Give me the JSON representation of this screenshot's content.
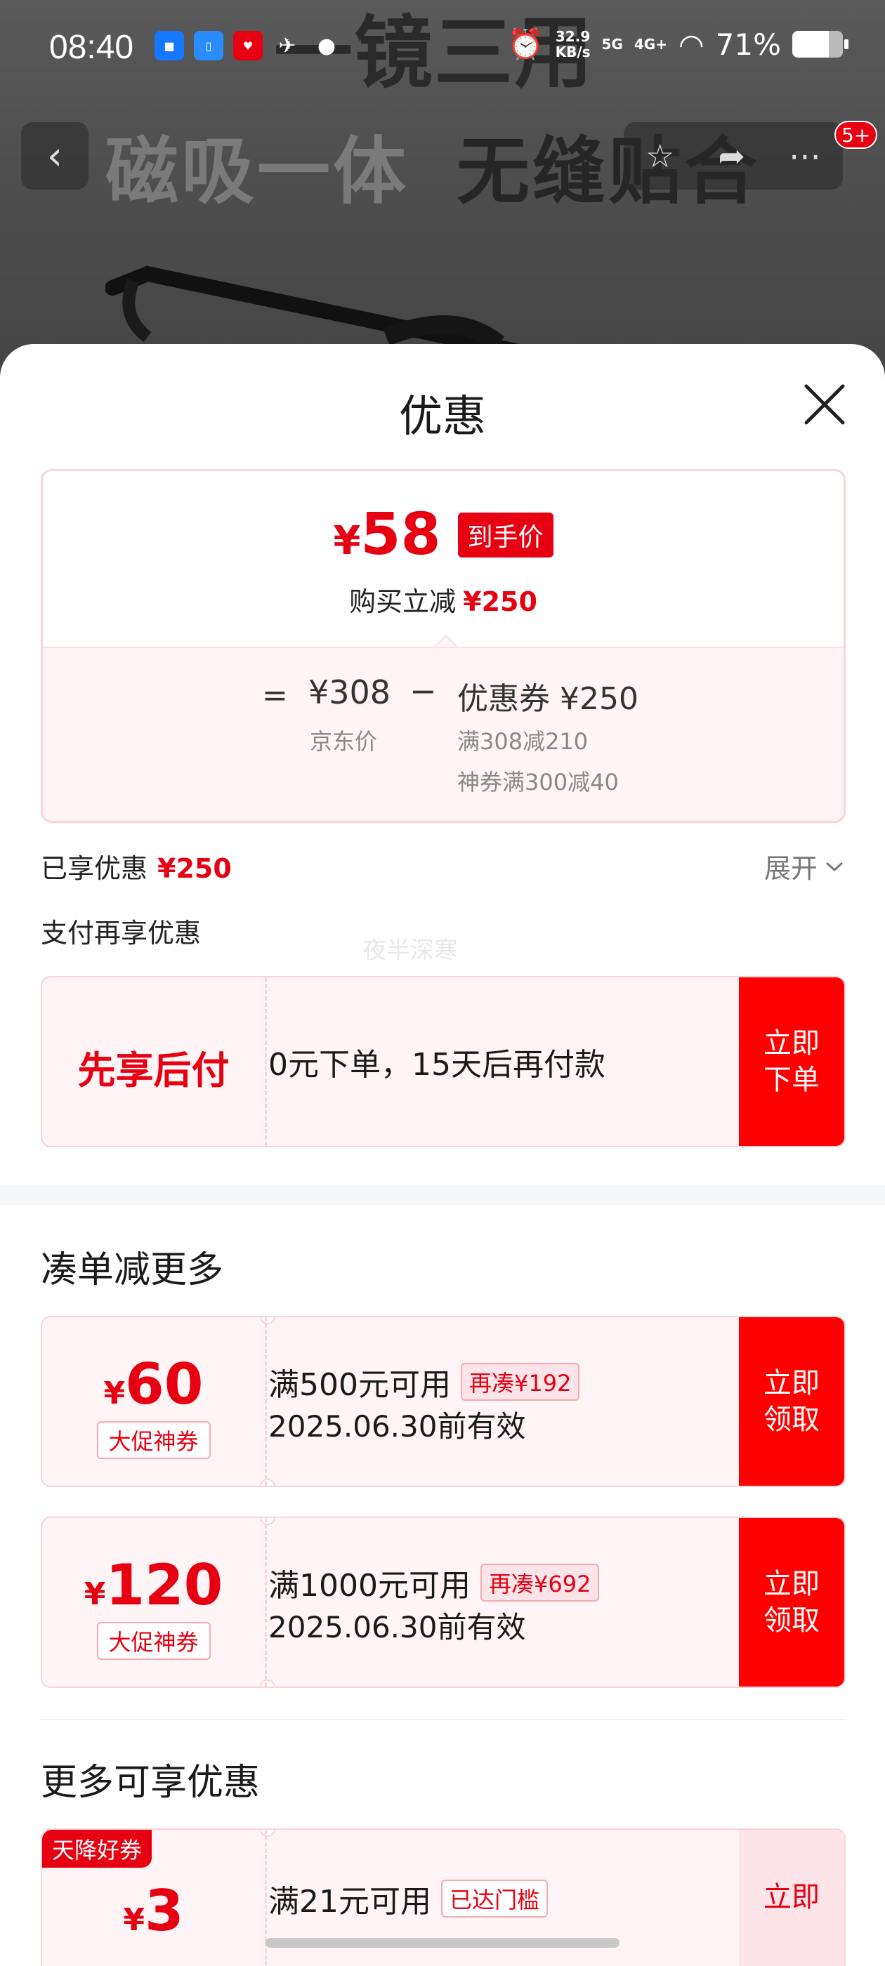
{
  "background": {
    "headline": "一镜三用",
    "sub_light": "磁吸一体",
    "sub_dark": "无缝贴合"
  },
  "status_bar": {
    "time": "08:40",
    "app_icons": [
      "pay-app-icon",
      "phone-app-icon",
      "gift-app-icon",
      "bird-app-icon",
      "wechat-icon"
    ],
    "net_speed_value": "32.9",
    "net_speed_unit": "KB/s",
    "signal_5g": "5G",
    "signal_4g": "4G+",
    "battery": "71%"
  },
  "product_nav": {
    "cart_badge": "5+"
  },
  "sheet": {
    "title": "优惠",
    "price_card": {
      "currency": "¥",
      "final_price": "58",
      "final_tag": "到手价",
      "saving_label": "购买立减",
      "saving_value": "¥250",
      "equals": "=",
      "jd_price": "¥308",
      "jd_label": "京东价",
      "minus": "−",
      "coupon_total": "优惠券 ¥250",
      "rule_1": "满308减210",
      "rule_2": "神券满300减40"
    },
    "enjoyed_label": "已享优惠",
    "enjoyed_value": "¥250",
    "expand_label": "展开",
    "pay_more_label": "支付再享优惠",
    "watermark": "夜半深寒",
    "bnpl": {
      "title": "先享后付",
      "description": "0元下单，15天后再付款",
      "cta": "立即下单"
    },
    "section_more": "凑单减更多",
    "coupons": [
      {
        "currency": "¥",
        "amount": "60",
        "type": "大促神券",
        "condition": "满500元可用",
        "tag": "再凑¥192",
        "validity": "2025.06.30前有效",
        "cta": "立即领取"
      },
      {
        "currency": "¥",
        "amount": "120",
        "type": "大促神券",
        "condition": "满1000元可用",
        "tag": "再凑¥692",
        "validity": "2025.06.30前有效",
        "cta": "立即领取"
      }
    ],
    "section_available": "更多可享优惠",
    "available_coupon": {
      "ribbon": "天降好券",
      "currency": "¥",
      "amount": "3",
      "condition": "满21元可用",
      "tag": "已达门槛",
      "cta": "立即"
    }
  },
  "colors": {
    "brand_red": "#e60012",
    "cta_red": "#ff0000",
    "card_bg": "#fff5f6",
    "card_border": "#fbd3d8"
  }
}
